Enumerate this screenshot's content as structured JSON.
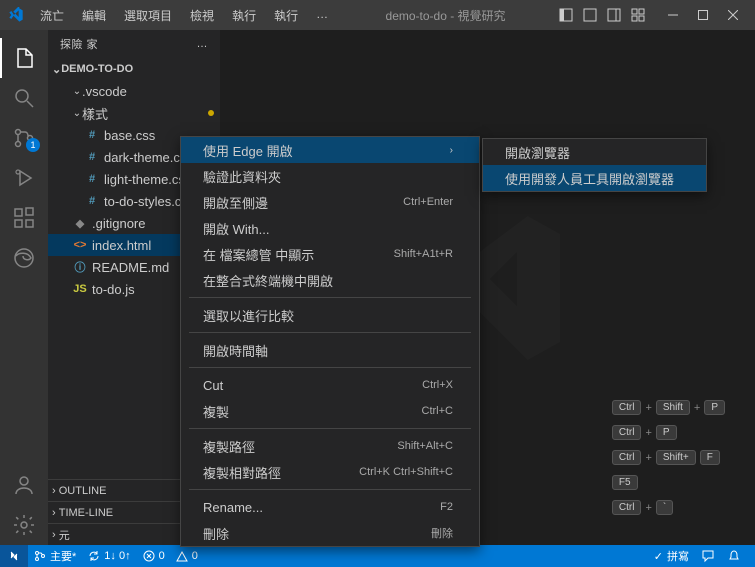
{
  "title": "demo-to-do - 視覺研究",
  "menubar": [
    "流亡",
    "編輯",
    "選取項目",
    "檢視",
    "執行",
    "執行",
    "…"
  ],
  "sidebar": {
    "title": "探險 家",
    "folder": "DEMO-TO-DO",
    "tree": [
      {
        "label": ".vscode",
        "icon": "chev",
        "indent": 1
      },
      {
        "label": "樣式",
        "icon": "chev",
        "indent": 1,
        "modified": true
      },
      {
        "label": "base.css",
        "icon": "#",
        "iconColor": "#519aba",
        "indent": 2
      },
      {
        "label": "dark-theme.css",
        "icon": "#",
        "iconColor": "#519aba",
        "indent": 2
      },
      {
        "label": "light-theme.css",
        "icon": "#",
        "iconColor": "#519aba",
        "indent": 2
      },
      {
        "label": "to-do-styles.css",
        "icon": "#",
        "iconColor": "#519aba",
        "indent": 2
      },
      {
        "label": ".gitignore",
        "icon": "◆",
        "iconColor": "#888",
        "indent": 1
      },
      {
        "label": "index.html",
        "icon": "<>",
        "iconColor": "#e37933",
        "indent": 1,
        "selected": true
      },
      {
        "label": "README.md",
        "icon": "ⓘ",
        "iconColor": "#519aba",
        "indent": 1
      },
      {
        "label": "to-do.js",
        "icon": "JS",
        "iconColor": "#cbcb41",
        "indent": 1
      }
    ],
    "outline": "OUTLINE",
    "timeline": "TIME-LINE",
    "npm": "元"
  },
  "activitybar": {
    "badge": "1"
  },
  "shortcuts": [
    [
      "Ctrl",
      "+",
      "Shift",
      "+",
      "P"
    ],
    [
      "Ctrl",
      "+",
      "P"
    ],
    [
      "Ctrl",
      "+",
      "Shift+",
      "",
      "F"
    ],
    [
      "F5"
    ],
    [
      "Ctrl",
      "+",
      "`"
    ]
  ],
  "contextMenu1": [
    {
      "label": "使用 Edge 開啟",
      "submenu": true,
      "hl": true
    },
    {
      "label": "驗證此資料夾"
    },
    {
      "label": "開啟至側邊",
      "kb": "Ctrl+Enter"
    },
    {
      "label": "開啟    With..."
    },
    {
      "label": "在 檔案總管 中顯示",
      "kb": "Shift+A1t+R"
    },
    {
      "label": "在整合式終端機中開啟"
    },
    {
      "sep": true
    },
    {
      "label": "選取以進行比較"
    },
    {
      "sep": true
    },
    {
      "label": "開啟時間軸"
    },
    {
      "sep": true
    },
    {
      "label": "Cut",
      "kb": "Ctrl+X"
    },
    {
      "label": "複製",
      "kb": "Ctrl+C"
    },
    {
      "sep": true
    },
    {
      "label": "複製路徑",
      "kb": "Shift+Alt+C"
    },
    {
      "label": "複製相對路徑",
      "kb": "Ctrl+K Ctrl+Shift+C"
    },
    {
      "sep": true
    },
    {
      "label": "Rename...",
      "kb": "F2"
    },
    {
      "label": "刪除",
      "kb": "刪除"
    }
  ],
  "contextMenu2": [
    {
      "label": "開啟瀏覽器"
    },
    {
      "label": "使用開發人員工具開啟瀏覽器",
      "hl": true
    }
  ],
  "statusbar": {
    "branch": "主要*",
    "sync": "1↓ 0↑",
    "errors": "0",
    "warnings": "0",
    "spellcheck": "拼寫"
  },
  "colors": {
    "accent": "#0078d4"
  }
}
